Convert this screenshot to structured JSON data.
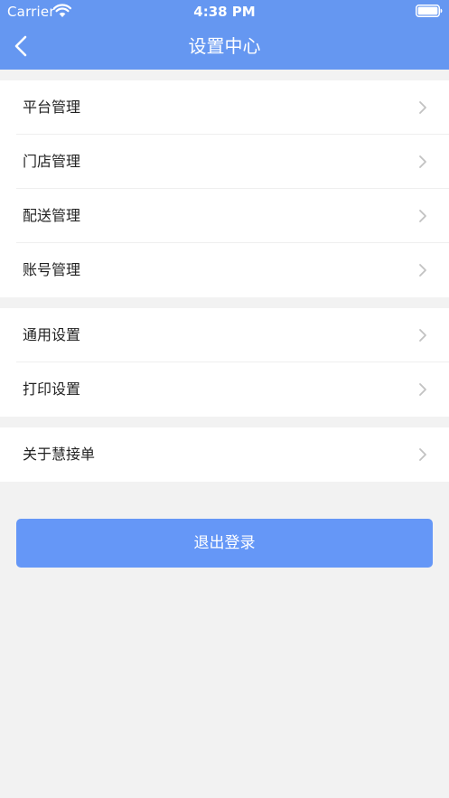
{
  "status_bar": {
    "carrier": "Carrier",
    "time": "4:38 PM"
  },
  "nav": {
    "title": "设置中心",
    "back_icon": "chevron-left-icon"
  },
  "groups": [
    {
      "items": [
        {
          "label": "平台管理"
        },
        {
          "label": "门店管理"
        },
        {
          "label": "配送管理"
        },
        {
          "label": "账号管理"
        }
      ]
    },
    {
      "items": [
        {
          "label": "通用设置"
        },
        {
          "label": "打印设置"
        }
      ]
    },
    {
      "items": [
        {
          "label": "关于慧接单"
        }
      ]
    }
  ],
  "logout": {
    "label": "退出登录"
  },
  "colors": {
    "header": "#6597f1",
    "button": "#6597f7",
    "background": "#f2f2f2",
    "chevron": "#c2c2c2"
  }
}
